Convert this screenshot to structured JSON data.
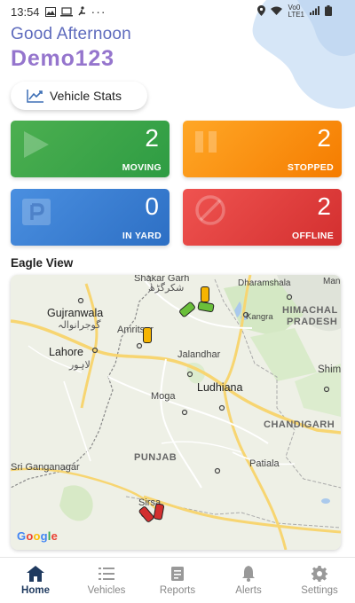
{
  "status_bar": {
    "time": "13:54",
    "network_label_top": "Vo0",
    "network_label_bottom": "LTE1"
  },
  "header": {
    "greeting": "Good Afternoon",
    "username": "Demo123"
  },
  "vehicle_stats_button": {
    "label": "Vehicle Stats"
  },
  "cards": {
    "moving": {
      "count": "2",
      "label": "MOVING",
      "color": "#4caf50"
    },
    "stopped": {
      "count": "2",
      "label": "STOPPED",
      "color": "#ffa726"
    },
    "in_yard": {
      "count": "0",
      "label": "IN YARD",
      "color": "#3d7fd6"
    },
    "offline": {
      "count": "2",
      "label": "OFFLINE",
      "color": "#e53935"
    }
  },
  "eagle_view": {
    "title": "Eagle View",
    "map_labels": {
      "shakargarh": "Shakar Garh",
      "shakargarh_urdu": "شکرگڑھ",
      "dharamshala": "Dharamshala",
      "man": "Man",
      "gujranwala": "Gujranwala",
      "gujranwala_urdu": "گوجرانوالہ",
      "amritsar": "Amritsar",
      "himachal": "HIMACHAL",
      "pradesh": "PRADESH",
      "kangra": "Kangra",
      "lahore": "Lahore",
      "lahore_urdu": "لاہور",
      "jalandhar": "Jalandhar",
      "shim": "Shim",
      "ludhiana": "Ludhiana",
      "moga": "Moga",
      "chandigarh": "CHANDIGARH",
      "punjab": "PUNJAB",
      "sri_ganganagar": "Sri Ganganagar",
      "patiala": "Patiala",
      "sirsa": "Sirsa"
    },
    "map_attribution": [
      "G",
      "o",
      "o",
      "g",
      "l",
      "e"
    ]
  },
  "bottom_nav": {
    "home": "Home",
    "vehicles": "Vehicles",
    "reports": "Reports",
    "alerts": "Alerts",
    "settings": "Settings"
  }
}
